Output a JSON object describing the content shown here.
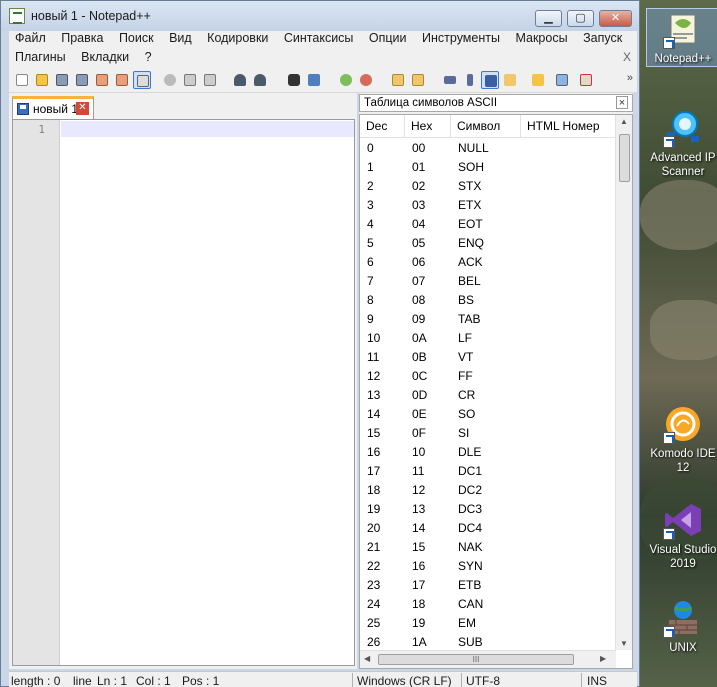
{
  "window": {
    "title": "новый 1 - Notepad++",
    "minimize_label": "▁",
    "maximize_label": "▢",
    "close_label": "✕"
  },
  "menu": {
    "row1": [
      "Файл",
      "Правка",
      "Поиск",
      "Вид",
      "Кодировки",
      "Синтаксисы",
      "Опции",
      "Инструменты",
      "Макросы",
      "Запуск"
    ],
    "row2": [
      "Плагины",
      "Вкладки",
      "?"
    ],
    "close_doc_label": "X"
  },
  "toolbar": {
    "icons": [
      "new-file-icon",
      "open-file-icon",
      "save-icon",
      "save-all-icon",
      "close-icon",
      "close-all-icon",
      "print-icon",
      "cut-icon",
      "copy-icon",
      "paste-icon",
      "undo-icon",
      "redo-icon",
      "find-icon",
      "replace-icon",
      "zoom-in-icon",
      "zoom-out-icon",
      "sync-vertical-icon",
      "sync-horizontal-icon",
      "word-wrap-icon",
      "show-all-chars-icon",
      "indent-guide-icon",
      "function-list-icon",
      "folder-as-workspace-icon",
      "document-map-icon",
      "record-macro-icon"
    ],
    "more_label": "»"
  },
  "editor": {
    "tab_label": "новый 1",
    "tab_close": "✕",
    "line_number": "1"
  },
  "ascii_panel": {
    "title": "Таблица символов ASCII",
    "close_label": "×",
    "columns": [
      "Dec",
      "Hex",
      "Символ",
      "HTML Номер"
    ],
    "rows": [
      [
        "0",
        "00",
        "NULL"
      ],
      [
        "1",
        "01",
        "SOH"
      ],
      [
        "2",
        "02",
        "STX"
      ],
      [
        "3",
        "03",
        "ETX"
      ],
      [
        "4",
        "04",
        "EOT"
      ],
      [
        "5",
        "05",
        "ENQ"
      ],
      [
        "6",
        "06",
        "ACK"
      ],
      [
        "7",
        "07",
        "BEL"
      ],
      [
        "8",
        "08",
        "BS"
      ],
      [
        "9",
        "09",
        "TAB"
      ],
      [
        "10",
        "0A",
        "LF"
      ],
      [
        "11",
        "0B",
        "VT"
      ],
      [
        "12",
        "0C",
        "FF"
      ],
      [
        "13",
        "0D",
        "CR"
      ],
      [
        "14",
        "0E",
        "SO"
      ],
      [
        "15",
        "0F",
        "SI"
      ],
      [
        "16",
        "10",
        "DLE"
      ],
      [
        "17",
        "11",
        "DC1"
      ],
      [
        "18",
        "12",
        "DC2"
      ],
      [
        "19",
        "13",
        "DC3"
      ],
      [
        "20",
        "14",
        "DC4"
      ],
      [
        "21",
        "15",
        "NAK"
      ],
      [
        "22",
        "16",
        "SYN"
      ],
      [
        "23",
        "17",
        "ETB"
      ],
      [
        "24",
        "18",
        "CAN"
      ],
      [
        "25",
        "19",
        "EM"
      ],
      [
        "26",
        "1A",
        "SUB"
      ]
    ],
    "hscroll_grip": "III"
  },
  "status": {
    "length": "length : 0",
    "lines": "line",
    "ln": "Ln : 1",
    "col": "Col : 1",
    "pos": "Pos : 1",
    "eol": "Windows (CR LF)",
    "encoding": "UTF-8",
    "mode": "INS"
  },
  "desktop": {
    "icons": [
      {
        "label": "Notepad++",
        "icon": "notepad-plus-plus-icon"
      },
      {
        "label": "Advanced IP Scanner",
        "icon": "advanced-ip-scanner-icon"
      },
      {
        "label": "Komodo IDE 12",
        "icon": "komodo-ide-icon"
      },
      {
        "label": "Visual Studio 2019",
        "icon": "visual-studio-icon"
      },
      {
        "label": "UNIX",
        "icon": "unix-icon"
      }
    ]
  }
}
